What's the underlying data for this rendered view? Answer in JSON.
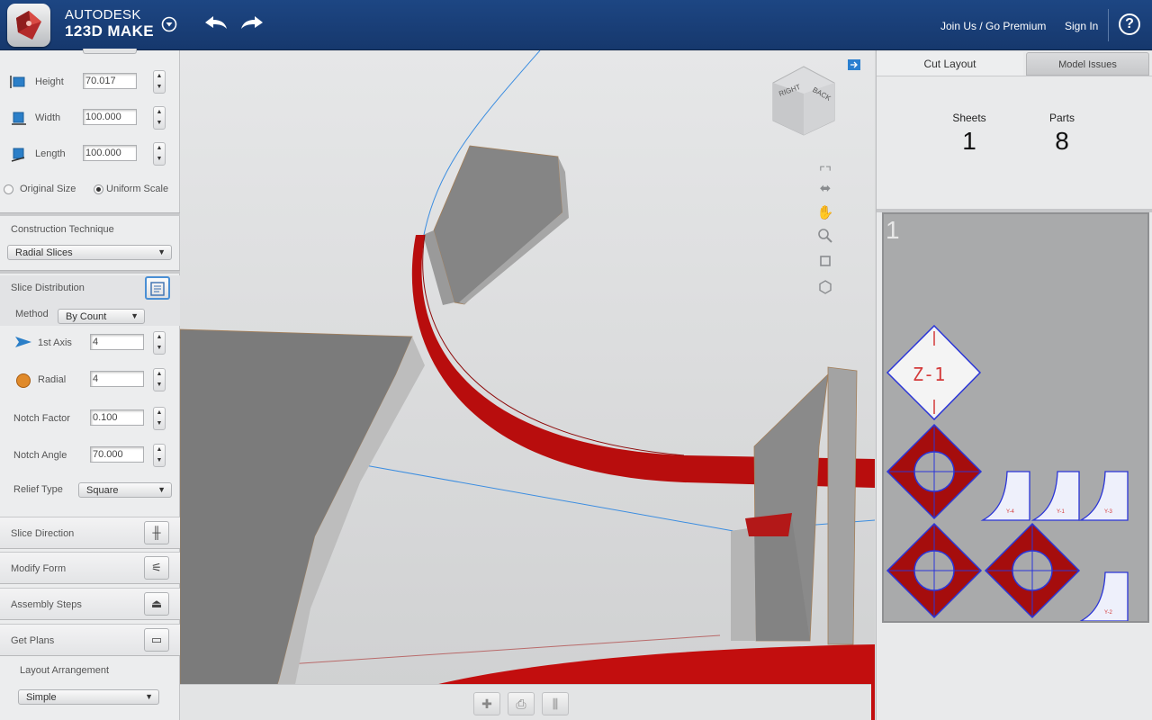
{
  "header": {
    "brand_line1": "AUTODESK",
    "brand_line2": "123D MAKE",
    "join_link": "Join Us / Go Premium",
    "sign_in": "Sign In",
    "help_glyph": "?"
  },
  "dimensions": {
    "height": {
      "label": "Height",
      "value": "70.017"
    },
    "width": {
      "label": "Width",
      "value": "100.000"
    },
    "length": {
      "label": "Length",
      "value": "100.000"
    },
    "original_size": "Original Size",
    "uniform_scale": "Uniform Scale",
    "selected_scale": "uniform"
  },
  "construction": {
    "label": "Construction Technique",
    "value": "Radial Slices"
  },
  "slice_distribution": {
    "label": "Slice Distribution",
    "method_label": "Method",
    "method_value": "By Count",
    "first_axis": {
      "label": "1st Axis",
      "value": "4"
    },
    "radial": {
      "label": "Radial",
      "value": "4"
    },
    "notch_factor": {
      "label": "Notch Factor",
      "value": "0.100"
    },
    "notch_angle": {
      "label": "Notch Angle",
      "value": "70.000"
    },
    "relief_type": {
      "label": "Relief Type",
      "value": "Square"
    }
  },
  "sections": {
    "slice_direction": "Slice Direction",
    "modify_form": "Modify Form",
    "assembly_steps": "Assembly Steps",
    "get_plans": "Get Plans",
    "layout_arrangement": "Layout Arrangement",
    "layout_value": "Simple"
  },
  "viewcube": {
    "right": "RIGHT",
    "back": "BACK"
  },
  "right_panel": {
    "tabs": [
      "Cut Layout",
      "Model Issues"
    ],
    "active_tab": "Cut Layout",
    "sheets_label": "Sheets",
    "sheets_value": "1",
    "parts_label": "Parts",
    "parts_value": "8",
    "sheet_number": "1",
    "part_label": "Z-1",
    "small_part_labels": [
      "Y-4",
      "Y-1",
      "Y-3",
      "Y-2"
    ]
  },
  "colors": {
    "header": "#1d4683",
    "slice_red": "#c00000",
    "part_outline": "#2b35d8",
    "sheet": "#a9aaab"
  }
}
